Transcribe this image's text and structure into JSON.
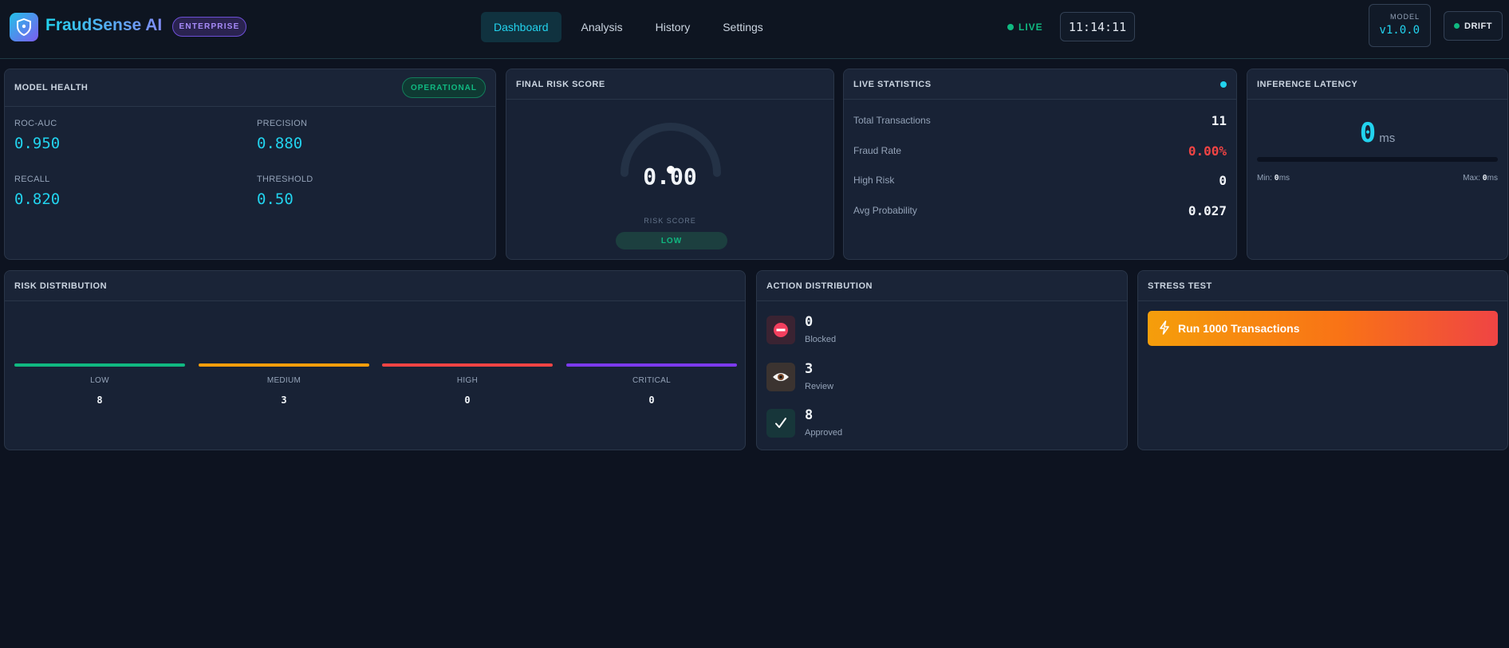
{
  "header": {
    "brand": "FraudSense AI",
    "edition": "ENTERPRISE",
    "nav": [
      "Dashboard",
      "Analysis",
      "History",
      "Settings"
    ],
    "active_nav": "Dashboard",
    "live_label": "LIVE",
    "clock": "11:14:11",
    "model_label": "MODEL",
    "model_version": "v1.0.0",
    "drift_label": "DRIFT"
  },
  "model_health": {
    "title": "MODEL HEALTH",
    "status": "OPERATIONAL",
    "metrics": [
      {
        "label": "ROC-AUC",
        "value": "0.950"
      },
      {
        "label": "PRECISION",
        "value": "0.880"
      },
      {
        "label": "RECALL",
        "value": "0.820"
      },
      {
        "label": "THRESHOLD",
        "value": "0.50"
      }
    ]
  },
  "risk_score": {
    "title": "FINAL RISK SCORE",
    "value": "0.00",
    "label": "RISK SCORE",
    "level": "LOW",
    "gauge_fraction": 0.0
  },
  "live_stats": {
    "title": "LIVE STATISTICS",
    "rows": [
      {
        "label": "Total Transactions",
        "value": "11"
      },
      {
        "label": "Fraud Rate",
        "value": "0.00%"
      },
      {
        "label": "High Risk",
        "value": "0"
      },
      {
        "label": "Avg Probability",
        "value": "0.027"
      }
    ]
  },
  "latency": {
    "title": "INFERENCE LATENCY",
    "value": "0",
    "unit": "ms",
    "min_label": "Min: ",
    "min_value": "0",
    "max_label": "Max: ",
    "max_value": "0",
    "ms": "ms",
    "bar_fraction": 0
  },
  "risk_distribution": {
    "title": "RISK DISTRIBUTION",
    "levels": [
      {
        "label": "LOW",
        "value": "8",
        "color": "#10b981"
      },
      {
        "label": "MEDIUM",
        "value": "3",
        "color": "#f59e0b"
      },
      {
        "label": "HIGH",
        "value": "0",
        "color": "#ef4444"
      },
      {
        "label": "CRITICAL",
        "value": "0",
        "color": "#7c3aed"
      }
    ]
  },
  "action_distribution": {
    "title": "ACTION DISTRIBUTION",
    "actions": [
      {
        "label": "Blocked",
        "value": "0",
        "icon": "no-entry-icon"
      },
      {
        "label": "Review",
        "value": "3",
        "icon": "eye-icon"
      },
      {
        "label": "Approved",
        "value": "8",
        "icon": "checkmark-icon"
      }
    ]
  },
  "stress_test": {
    "title": "STRESS TEST",
    "button": "Run 1000 Transactions",
    "icon": "lightning-icon"
  }
}
